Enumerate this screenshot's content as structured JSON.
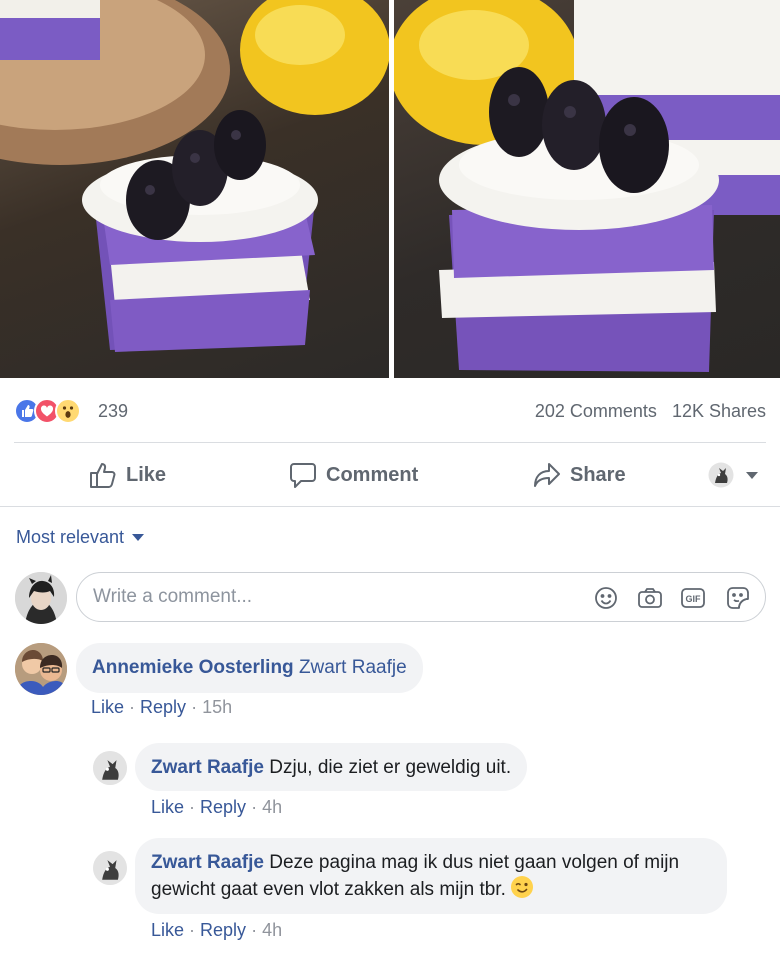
{
  "post": {
    "photos": [
      {
        "icon": "blackberry-cake-photo"
      },
      {
        "icon": "blackberry-cake-photo"
      }
    ]
  },
  "reactions": {
    "icons": [
      "like-icon",
      "love-icon",
      "wow-icon"
    ],
    "count": "239",
    "comments": "202 Comments",
    "shares": "12K Shares"
  },
  "actions": {
    "like": "Like",
    "comment": "Comment",
    "share": "Share"
  },
  "sort": {
    "label": "Most relevant"
  },
  "composer": {
    "placeholder": "Write a comment..."
  },
  "comments": [
    {
      "author": "Annemieke Oosterling",
      "tag": "Zwart Raafje",
      "text": "",
      "like": "Like",
      "reply": "Reply",
      "time": "15h"
    }
  ],
  "replies": [
    {
      "author": "Zwart Raafje",
      "text": "Dzju, die ziet er geweldig uit.",
      "like": "Like",
      "reply": "Reply",
      "time": "4h"
    },
    {
      "author": "Zwart Raafje",
      "text": "Deze pagina mag ik dus niet gaan volgen of mijn gewicht gaat even vlot zakken als mijn tbr.",
      "like": "Like",
      "reply": "Reply",
      "time": "4h"
    }
  ],
  "colors": {
    "link": "#385898",
    "meta": "#90949c",
    "bubble": "#f2f3f5",
    "like_reaction": "#4a76e8",
    "love_reaction": "#f25268",
    "cake_purple": "#7b5cc4"
  }
}
